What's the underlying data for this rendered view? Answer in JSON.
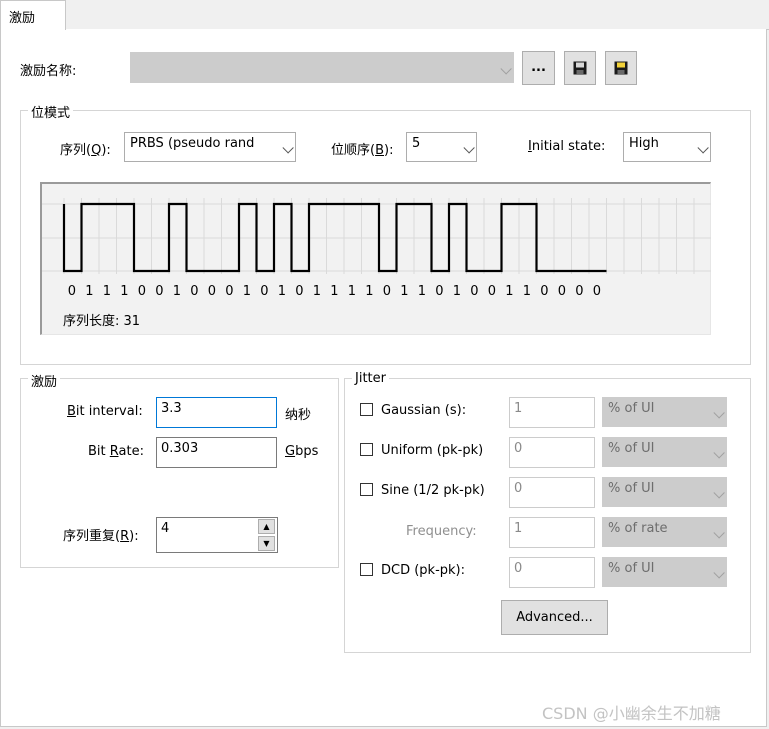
{
  "tab": {
    "label": "激励"
  },
  "stim_name": {
    "label": "激励名称:",
    "value": "",
    "browse_label": "..."
  },
  "bit_pattern": {
    "group_label": "位模式",
    "sequence": {
      "label": "序列",
      "key": "Q",
      "value": "PRBS (pseudo rand"
    },
    "bit_order": {
      "label": "位顺序",
      "key": "B",
      "value": "5"
    },
    "initial_state": {
      "key": "I",
      "label_rest": "nitial state:",
      "value": "High"
    },
    "bits": [
      0,
      1,
      1,
      1,
      0,
      0,
      1,
      0,
      0,
      0,
      1,
      0,
      1,
      0,
      1,
      1,
      1,
      1,
      0,
      1,
      1,
      0,
      1,
      0,
      0,
      1,
      1,
      0,
      0,
      0,
      0
    ],
    "length_label": "序列长度: 31"
  },
  "stimulus": {
    "group_label": "激励",
    "bit_interval": {
      "key": "B",
      "label_rest": "it interval:",
      "value": "3.3",
      "unit": "纳秒"
    },
    "bit_rate": {
      "label_pre": "Bit ",
      "key": "R",
      "label_rest": "ate:",
      "value": "0.303",
      "unit_key": "G",
      "unit_rest": "bps"
    },
    "repeat": {
      "label": "序列重复",
      "key": "R",
      "value": "4"
    }
  },
  "jitter": {
    "group_label": "Jitter",
    "rows": [
      {
        "label": "Gaussian (s):",
        "value": "1",
        "unit": "% of UI"
      },
      {
        "label": "Uniform (pk-pk)",
        "value": "0",
        "unit": "% of UI"
      },
      {
        "label": "Sine (1/2 pk-pk)",
        "value": "0",
        "unit": "% of UI"
      },
      {
        "label": "DCD (pk-pk):",
        "value": "0",
        "unit": "% of UI"
      }
    ],
    "frequency": {
      "label": "Frequency:",
      "value": "1",
      "unit": "% of rate"
    },
    "advanced_label": "Advanced..."
  },
  "watermark": "CSDN @小幽余生不加糖",
  "colors": {
    "accent": "#0078d7",
    "border": "#adadad",
    "disabled": "#cccccc"
  }
}
